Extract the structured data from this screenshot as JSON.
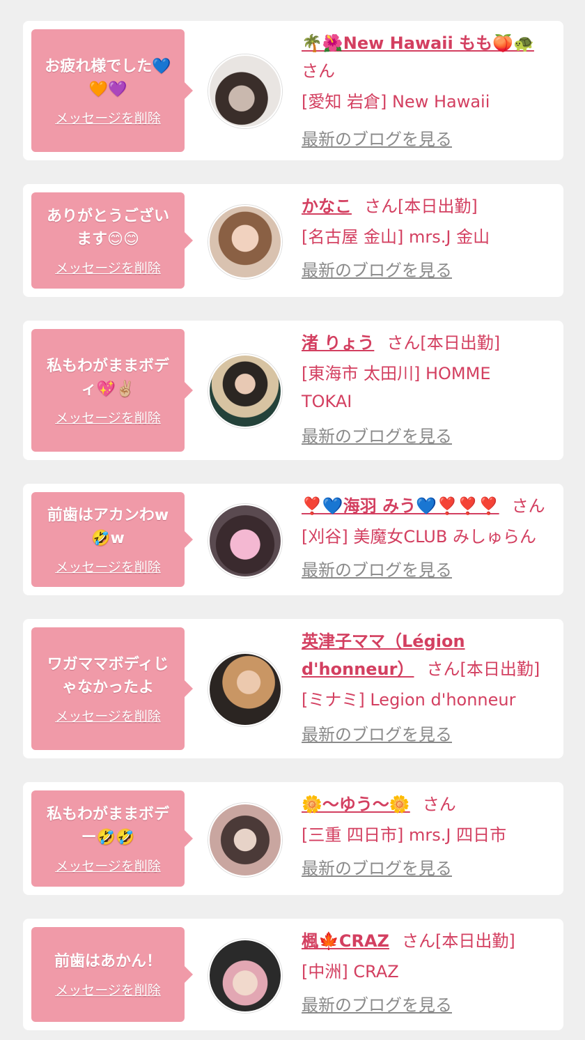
{
  "items": [
    {
      "message": "お疲れ様でした💙\n🧡💜",
      "delete_label": "メッセージを削除",
      "name": "🌴🌺New Hawaii もも🍑🐢",
      "honorific": "さん",
      "shop": "[愛知 岩倉] New Hawaii",
      "blog_link": "最新のブログを見る"
    },
    {
      "message": "ありがとうござい\nます😊😊",
      "delete_label": "メッセージを削除",
      "name": "かなこ",
      "honorific": "さん[本日出勤]",
      "shop": "[名古屋 金山] mrs.J 金山",
      "blog_link": "最新のブログを見る"
    },
    {
      "message": "私もわがままボデ\nィ💖✌🏼",
      "delete_label": "メッセージを削除",
      "name": "渚 りょう",
      "honorific": "さん[本日出勤]",
      "shop": "[東海市 太田川] HOMME\nTOKAI",
      "blog_link": "最新のブログを見る"
    },
    {
      "message": "前歯はアカンわw\n🤣w",
      "delete_label": "メッセージを削除",
      "name": "❣️💙海羽 みう💙❣️❣️❣️",
      "honorific": "さん",
      "shop": "[刈谷] 美魔女CLUB みしゅらん",
      "blog_link": "最新のブログを見る"
    },
    {
      "message": "ワガママボディじ\nゃなかったよ",
      "delete_label": "メッセージを削除",
      "name": "英津子ママ（Légion\nd'honneur）",
      "honorific": "さん[本日出勤]",
      "shop": "[ミナミ] Legion d'honneur",
      "blog_link": "最新のブログを見る"
    },
    {
      "message": "私もわがままボデ\nー🤣🤣",
      "delete_label": "メッセージを削除",
      "name": "🌼〜ゆう〜🌼",
      "honorific": "さん",
      "shop": "[三重 四日市] mrs.J 四日市",
      "blog_link": "最新のブログを見る"
    },
    {
      "message": "前歯はあかん！",
      "delete_label": "メッセージを削除",
      "name": "楓🍁CRAZ",
      "honorific": "さん[本日出勤]",
      "shop": "[中洲] CRAZ",
      "blog_link": "最新のブログを見る"
    }
  ],
  "colors": {
    "page_bg": "#efefef",
    "card_bg": "#ffffff",
    "bubble_bg": "#f09aa8",
    "accent_text": "#d33f60",
    "link_gray": "#8a8a8a"
  }
}
